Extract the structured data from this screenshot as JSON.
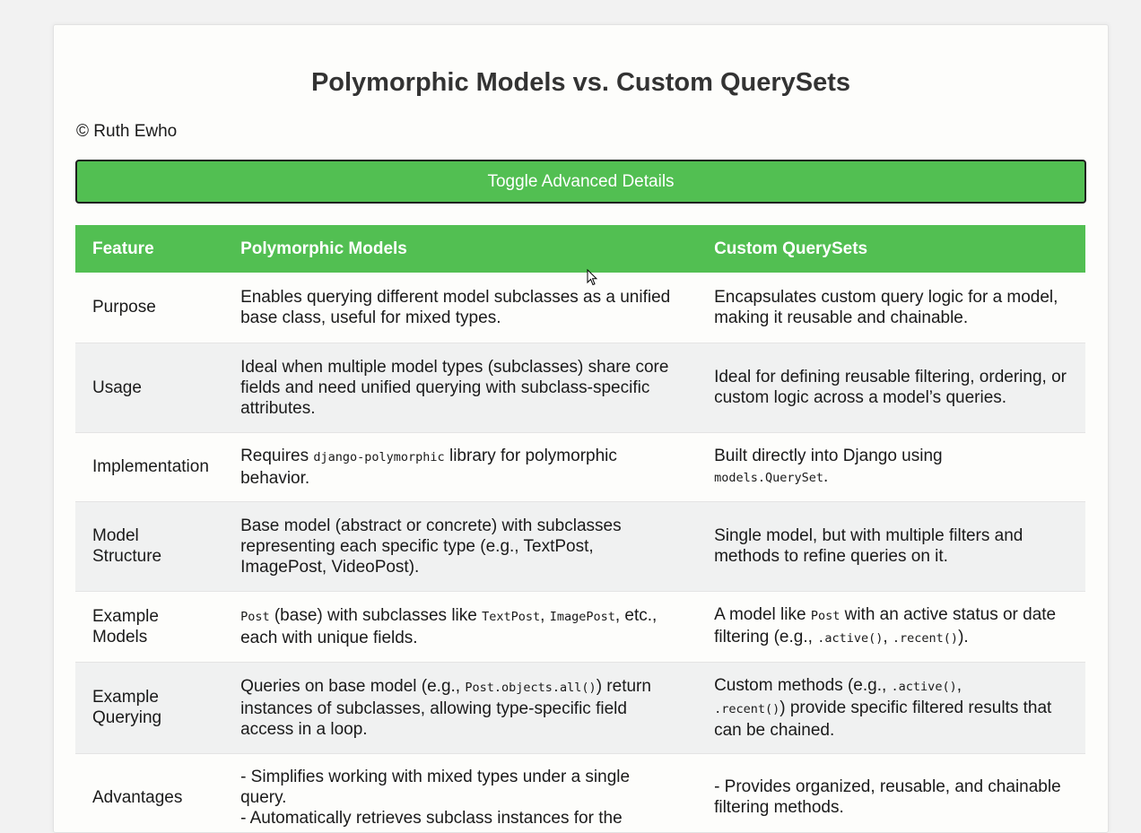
{
  "page": {
    "title": "Polymorphic Models vs. Custom QuerySets",
    "copyright": "© Ruth Ewho",
    "toggle_button": "Toggle Advanced Details"
  },
  "table": {
    "headers": [
      "Feature",
      "Polymorphic Models",
      "Custom QuerySets"
    ],
    "rows": [
      {
        "feature": "Purpose",
        "poly": "Enables querying different model subclasses as a unified base class, useful for mixed types.",
        "qs": "Encapsulates custom query logic for a model, making it reusable and chainable."
      },
      {
        "feature": "Usage",
        "poly": "Ideal when multiple model types (subclasses) share core fields and need unified querying with subclass-specific attributes.",
        "qs": "Ideal for defining reusable filtering, ordering, or custom logic across a model’s queries."
      },
      {
        "feature": "Implementation",
        "poly_a": "Requires ",
        "poly_code": "django-polymorphic",
        "poly_b": " library for polymorphic behavior.",
        "qs_a": "Built directly into Django using ",
        "qs_code": "models.QuerySet",
        "qs_b": "."
      },
      {
        "feature": "Model Structure",
        "poly": "Base model (abstract or concrete) with subclasses representing each specific type (e.g., TextPost, ImagePost, VideoPost).",
        "qs": "Single model, but with multiple filters and methods to refine queries on it."
      },
      {
        "feature": "Example Models",
        "poly_code1": "Post",
        "poly_t1": " (base) with subclasses like ",
        "poly_code2": "TextPost",
        "poly_t2": ", ",
        "poly_code3": "ImagePost",
        "poly_t3": ", etc., each with unique fields.",
        "qs_t1": "A model like ",
        "qs_code1": "Post",
        "qs_t2": " with an active status or date filtering (e.g., ",
        "qs_code2": ".active()",
        "qs_t3": ", ",
        "qs_code3": ".recent()",
        "qs_t4": ")."
      },
      {
        "feature": "Example Querying",
        "poly_t1": "Queries on base model (e.g., ",
        "poly_code1": "Post.objects.all()",
        "poly_t2": ") return instances of subclasses, allowing type-specific field access in a loop.",
        "qs_t1": "Custom methods (e.g., ",
        "qs_code1": ".active()",
        "qs_t2": ", ",
        "qs_code2": ".recent()",
        "qs_t3": ") provide specific filtered results that can be chained."
      },
      {
        "feature": "Advantages",
        "poly_l1": "- Simplifies working with mixed types under a single query.",
        "poly_l2": "- Automatically retrieves subclass instances for the",
        "qs_l1": "- Provides organized, reusable, and chainable filtering methods."
      }
    ]
  }
}
